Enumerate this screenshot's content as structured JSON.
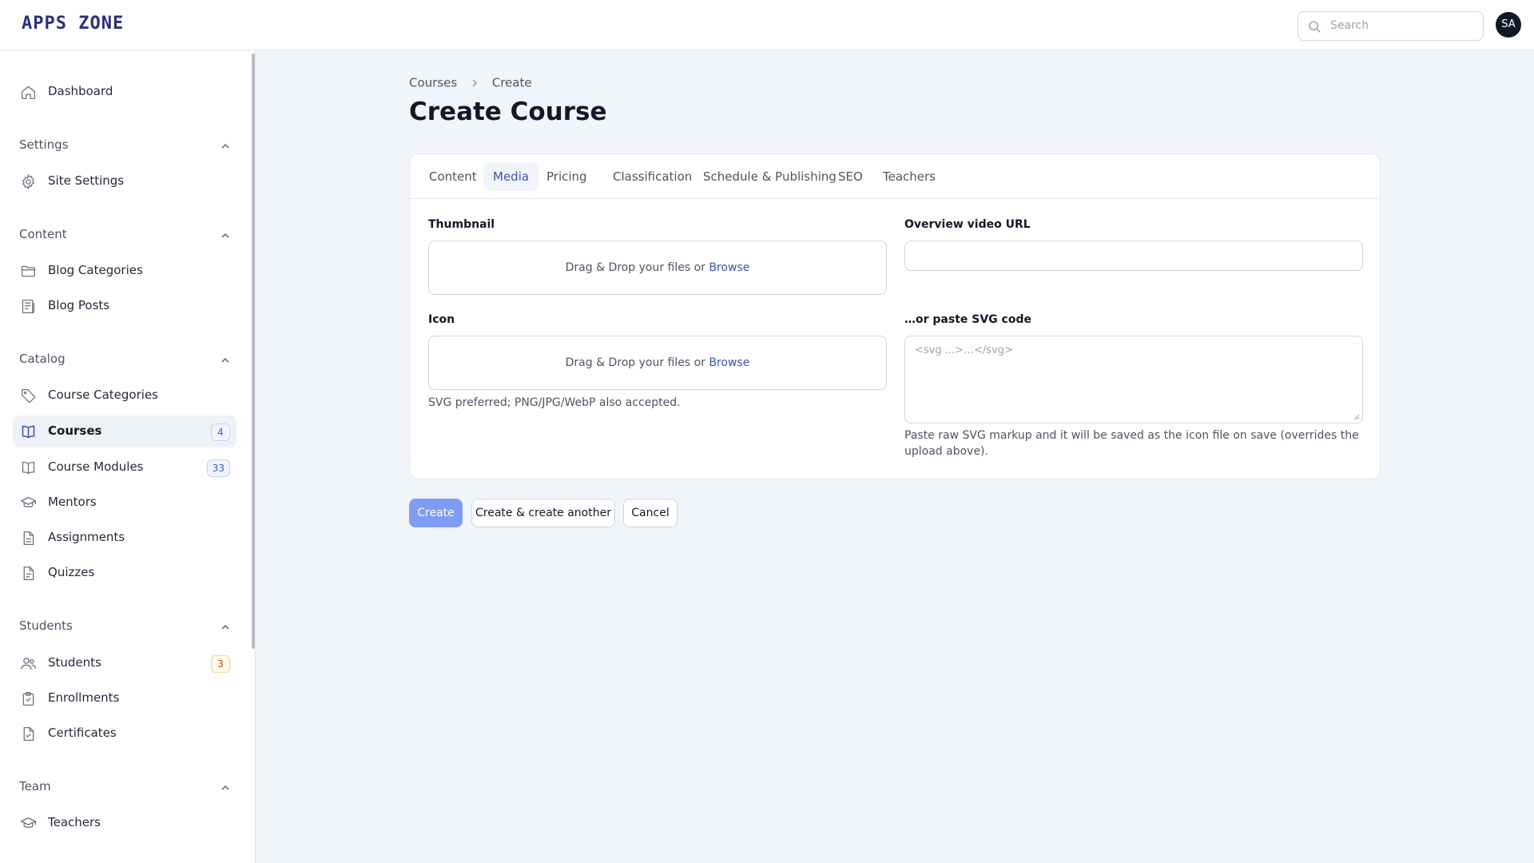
{
  "app": {
    "logo": "APPS ZONE",
    "avatar_initials": "SA"
  },
  "search": {
    "placeholder": "Search"
  },
  "sidebar": {
    "dashboard": "Dashboard",
    "groups": {
      "settings": {
        "label": "Settings",
        "items": {
          "site_settings": "Site Settings"
        }
      },
      "content": {
        "label": "Content",
        "items": {
          "blog_categories": "Blog Categories",
          "blog_posts": "Blog Posts"
        }
      },
      "catalog": {
        "label": "Catalog",
        "items": {
          "course_categories": "Course Categories",
          "courses": "Courses",
          "courses_badge": "4",
          "course_modules": "Course Modules",
          "course_modules_badge": "33",
          "mentors": "Mentors",
          "assignments": "Assignments",
          "quizzes": "Quizzes"
        }
      },
      "students": {
        "label": "Students",
        "items": {
          "students": "Students",
          "students_badge": "3",
          "enrollments": "Enrollments",
          "certificates": "Certificates"
        }
      },
      "team": {
        "label": "Team",
        "items": {
          "teachers": "Teachers"
        }
      }
    },
    "active_item": "Courses"
  },
  "breadcrumb": {
    "parent": "Courses",
    "current": "Create"
  },
  "page": {
    "title": "Create Course"
  },
  "tabs": {
    "content": "Content",
    "media": "Media",
    "pricing": "Pricing",
    "classification": "Classification",
    "schedule": "Schedule & Publishing",
    "seo": "SEO",
    "teachers": "Teachers",
    "active": "Media"
  },
  "form": {
    "thumbnail_label": "Thumbnail",
    "dropzone_text": "Drag & Drop your files or",
    "dropzone_link": "Browse",
    "icon_label": "Icon",
    "icon_help": "SVG preferred; PNG/JPG/WebP also accepted.",
    "video_label": "Overview video URL",
    "video_value": "",
    "svg_label": "…or paste SVG code",
    "svg_placeholder": "<svg ...>…</svg>",
    "svg_help": "Paste raw SVG markup and it will be saved as the icon file on save (overrides the upload above)."
  },
  "actions": {
    "create": "Create",
    "create_another": "Create & create another",
    "cancel": "Cancel"
  },
  "colors": {
    "accent": "#3b52b4",
    "primary_button": "#7f9cf5",
    "page_bg": "#f1f4f9",
    "logo": "#2b2f7a"
  }
}
